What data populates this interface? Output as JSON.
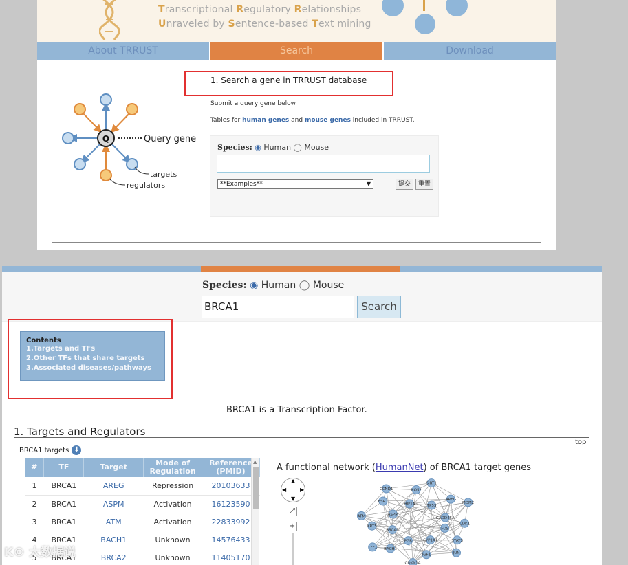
{
  "banner": {
    "line1": [
      {
        "cap": "T",
        "rest": "ranscriptional "
      },
      {
        "cap": "R",
        "rest": "egulatory "
      },
      {
        "cap": "R",
        "rest": "elationships"
      }
    ],
    "line2": [
      {
        "cap": "U",
        "rest": "nraveled by "
      },
      {
        "cap": "S",
        "rest": "entence-based "
      },
      {
        "cap": "T",
        "rest": "ext mining"
      }
    ]
  },
  "nav": {
    "about": "About TRRUST",
    "search": "Search",
    "download": "Download"
  },
  "diagram": {
    "center": "Q",
    "query_label": "Query gene",
    "targets_label": "targets",
    "regulators_label": "regulators"
  },
  "search_page": {
    "title": "1. Search a gene in TRRUST database",
    "submit_text": "Submit a query gene below.",
    "tables_prefix": "Tables for ",
    "human_link": "human genes",
    "and_text": " and ",
    "mouse_link": "mouse genes",
    "tables_suffix": " included in TRRUST.",
    "species_label": "Species:",
    "human_option": "Human",
    "mouse_option": "Mouse",
    "examples": "**Examples**",
    "submit_btn": "提交",
    "reset_btn": "重置"
  },
  "results": {
    "species_label": "Species:",
    "human_option": "Human",
    "mouse_option": "Mouse",
    "query_value": "BRCA1",
    "search_btn": "Search",
    "contents": {
      "title": "Contents",
      "items": [
        "1.Targets and TFs",
        "2.Other TFs that share targets",
        "3.Associated diseases/pathways"
      ]
    },
    "tf_statement": "BRCA1 is a Transcription Factor.",
    "section1": "1. Targets and Regulators",
    "top_link": "top",
    "targets_label": "BRCA1 targets",
    "table": {
      "headers": [
        "#",
        "TF",
        "Target",
        "Mode of Regulation",
        "Reference (PMID)"
      ],
      "rows": [
        [
          "1",
          "BRCA1",
          "AREG",
          "Repression",
          "20103633"
        ],
        [
          "2",
          "BRCA1",
          "ASPM",
          "Activation",
          "16123590"
        ],
        [
          "3",
          "BRCA1",
          "ATM",
          "Activation",
          "22833992"
        ],
        [
          "4",
          "BRCA1",
          "BACH1",
          "Unknown",
          "14576433"
        ],
        [
          "5",
          "BRCA1",
          "BRCA2",
          "Unknown",
          "11405170"
        ]
      ]
    },
    "network": {
      "prefix": "A functional network (",
      "link": "HumanNet",
      "suffix": ") of BRCA1 target genes",
      "nodes": [
        "FOS",
        "STAT3",
        "JUN",
        "CYP1A1",
        "IGF1",
        "CDKN1A",
        "PGR",
        "BACH1",
        "TFF1",
        "BRCA2",
        "KRT5",
        "ATM",
        "ASPM",
        "ESR1",
        "CCND1",
        "HIF1A",
        "NOS2",
        "SIRT1",
        "TP53",
        "AREG",
        "MDM2",
        "GADD45A",
        "CDK1"
      ]
    }
  },
  "watermark": "K© 大数据说"
}
